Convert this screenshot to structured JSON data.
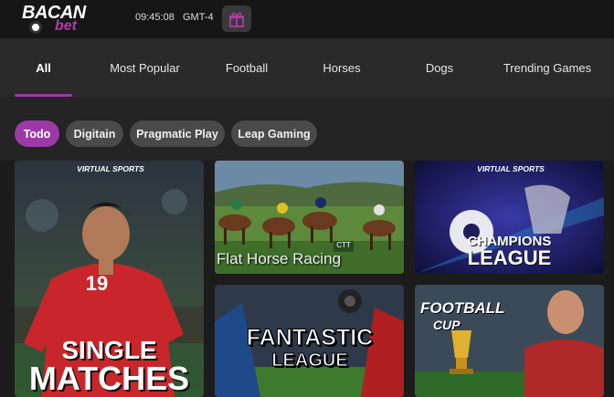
{
  "header": {
    "logo": {
      "word1": "BACAN",
      "word2": "bet"
    },
    "time": "09:45:08",
    "timezone": "GMT-4",
    "gift_icon": "gift-icon"
  },
  "nav": {
    "tabs": [
      {
        "label": "All",
        "active": true
      },
      {
        "label": "Most Popular",
        "active": false
      },
      {
        "label": "Football",
        "active": false
      },
      {
        "label": "Horses",
        "active": false
      },
      {
        "label": "Dogs",
        "active": false
      },
      {
        "label": "Trending Games",
        "active": false
      }
    ]
  },
  "providers": {
    "chips": [
      {
        "label": "Todo",
        "active": true
      },
      {
        "label": "Digitain",
        "active": false
      },
      {
        "label": "Pragmatic Play",
        "active": false
      },
      {
        "label": "Leap Gaming",
        "active": false
      }
    ]
  },
  "games": [
    {
      "brand": "VIRTUAL SPORTS",
      "title_line1": "SINGLE",
      "title_line2": "MATCHES",
      "jersey": "19"
    },
    {
      "title": "Flat Horse Racing",
      "sign": "CTT"
    },
    {
      "brand": "VIRTUAL SPORTS",
      "title_line1": "CHAMPIONS",
      "title_line2": "LEAGUE"
    },
    {
      "title_line1": "FANTASTIC",
      "title_line2": "LEAGUE"
    },
    {
      "title_line1": "FOOTBALL",
      "title_line2": "CUP"
    }
  ],
  "colors": {
    "accent": "#9b3aa6",
    "background": "#222222",
    "topbar": "#161616"
  }
}
